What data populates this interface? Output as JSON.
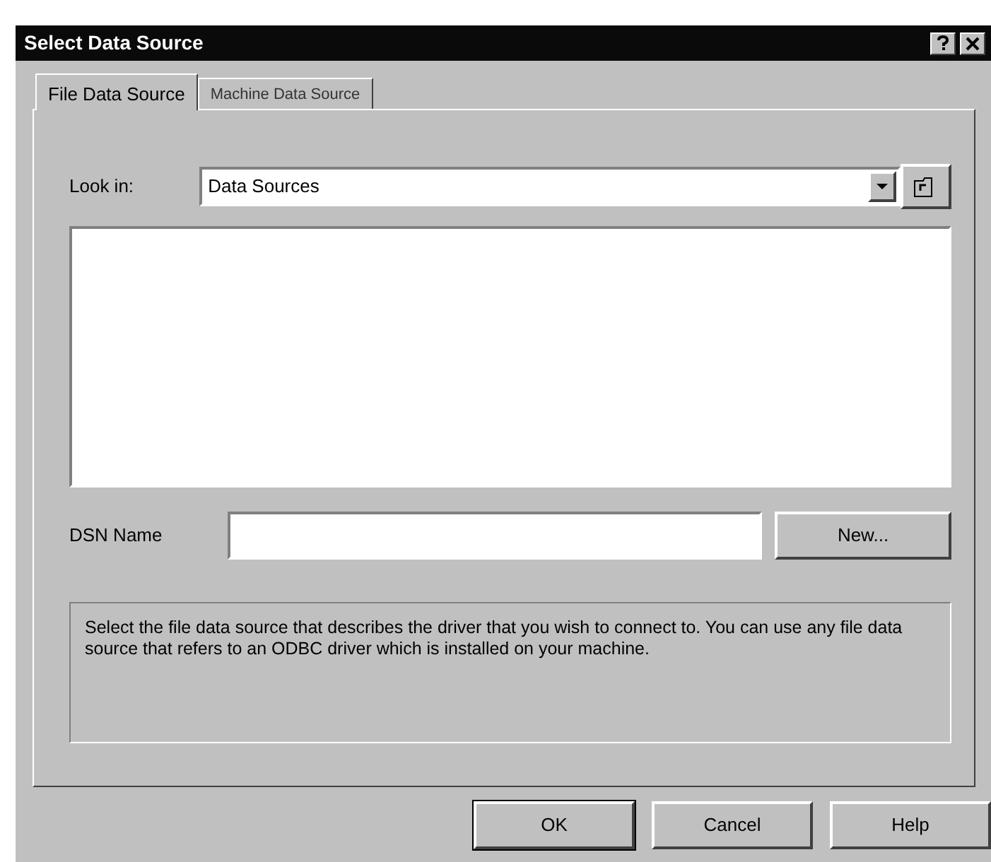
{
  "window": {
    "title": "Select Data Source"
  },
  "tabs": [
    {
      "label": "File Data Source",
      "selected": true
    },
    {
      "label": "Machine Data Source",
      "selected": false
    }
  ],
  "look_in": {
    "label": "Look in:",
    "value": "Data Sources"
  },
  "dsn": {
    "label": "DSN Name"
  },
  "new_button": "New...",
  "description": "Select the file data source that describes the driver that you wish to connect to. You can use any file data source that refers to an ODBC driver which is installed on your machine.",
  "buttons": [
    {
      "label": "OK",
      "default": true
    },
    {
      "label": "Cancel",
      "default": false
    },
    {
      "label": "Help",
      "default": false
    }
  ]
}
